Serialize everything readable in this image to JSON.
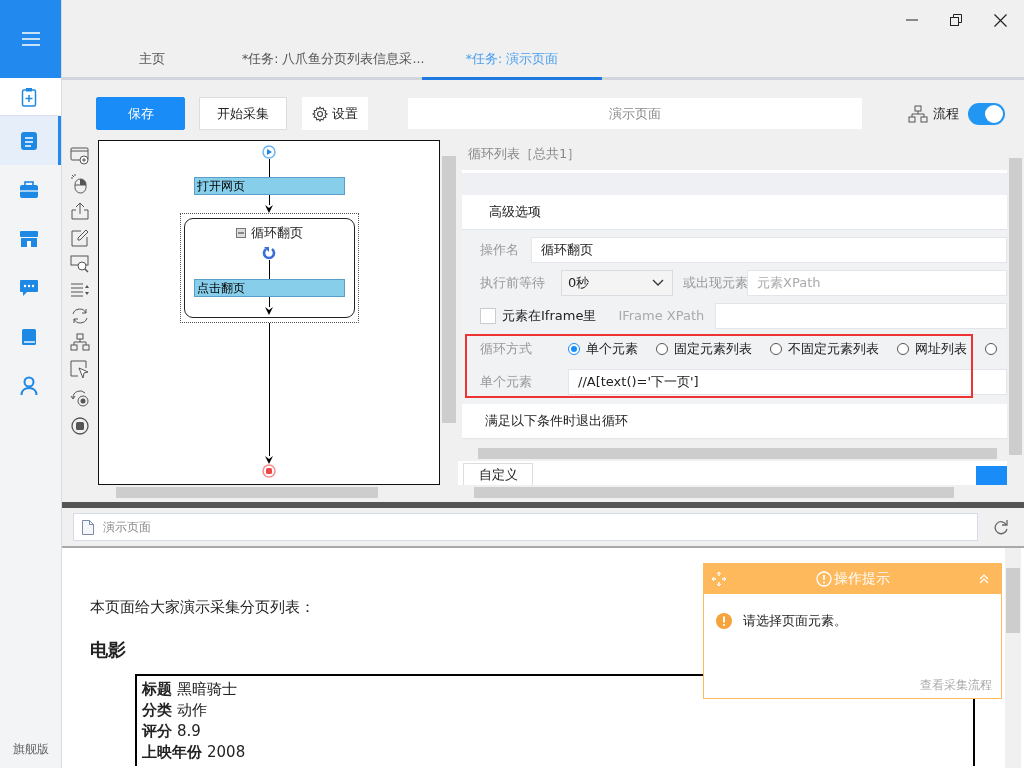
{
  "sidebar": {
    "items": [
      {
        "selected": false
      },
      {
        "selected": true
      },
      {
        "selected": false
      },
      {
        "selected": false
      },
      {
        "selected": false
      },
      {
        "selected": false
      },
      {
        "selected": false
      }
    ],
    "edition": "旗舰版"
  },
  "tabs": [
    {
      "label": "主页",
      "selected": false
    },
    {
      "label": "*任务: 八爪鱼分页列表信息采...",
      "selected": false
    },
    {
      "label": "*任务: 演示页面",
      "selected": true
    }
  ],
  "toolbar": {
    "save": "保存",
    "start": "开始采集",
    "settings": "设置",
    "page_title": "演示页面",
    "flow": {
      "label": "流程",
      "on": true
    }
  },
  "flow": {
    "steps": [
      {
        "kind": "start"
      },
      {
        "kind": "action",
        "label": "打开网页"
      },
      {
        "kind": "loop",
        "label": "循环翻页",
        "expanded": true,
        "selected": true,
        "children": [
          {
            "kind": "action",
            "label": "点击翻页"
          }
        ]
      },
      {
        "kind": "end"
      }
    ]
  },
  "panel": {
    "title": "循环列表［总共1］",
    "section": "高级选项",
    "operation_name": {
      "label": "操作名",
      "value": "循环翻页"
    },
    "wait": {
      "label": "执行前等待",
      "value": "0秒"
    },
    "appear": {
      "label": "或出现元素",
      "placeholder": "元素XPath"
    },
    "iframe": {
      "label": "元素在Iframe里",
      "checked": false,
      "xpath_label": "IFrame XPath"
    },
    "loop_mode": {
      "label": "循环方式",
      "options": [
        {
          "label": "单个元素",
          "selected": true
        },
        {
          "label": "固定元素列表",
          "selected": false
        },
        {
          "label": "不固定元素列表",
          "selected": false
        },
        {
          "label": "网址列表",
          "selected": false
        },
        {
          "selected": false
        }
      ]
    },
    "single_element": {
      "label": "单个元素",
      "value": "//A[text()='下一页']"
    },
    "exit_section": "满足以下条件时退出循环",
    "custom_tab": "自定义"
  },
  "browser": {
    "address": "演示页面",
    "intro": "本页面给大家演示采集分页列表：",
    "heading": "电影",
    "record": [
      {
        "label": "标题",
        "value": "黑暗骑士"
      },
      {
        "label": "分类",
        "value": "动作"
      },
      {
        "label": "评分",
        "value": "8.9"
      },
      {
        "label": "上映年份",
        "value": "2008"
      }
    ]
  },
  "tip": {
    "title": "操作提示",
    "message": "请选择页面元素。",
    "link": "查看采集流程"
  }
}
